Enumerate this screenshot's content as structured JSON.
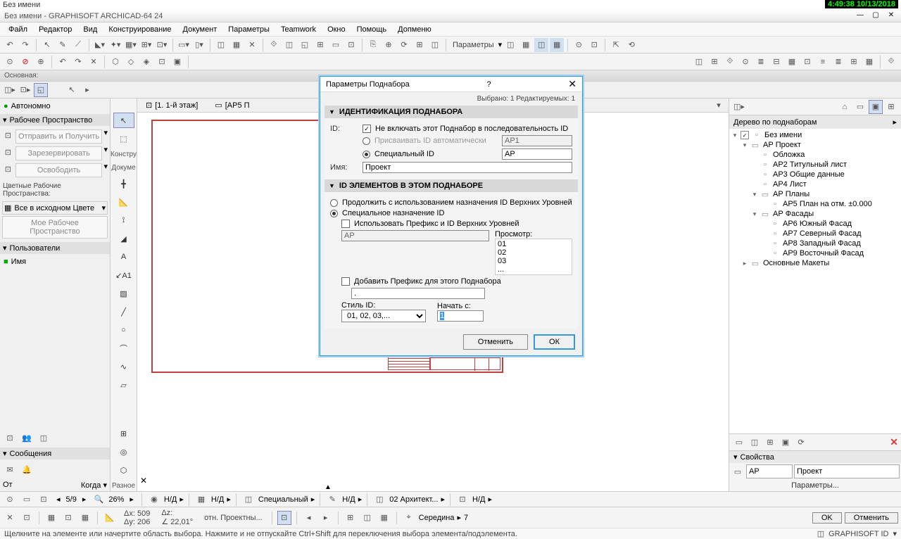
{
  "timestamp": "4:49:38  10/13/2018",
  "app_title": "Без имени - GRAPHISOFT ARCHICAD-64 24",
  "menu": [
    "Файл",
    "Редактор",
    "Вид",
    "Конструирование",
    "Документ",
    "Параметры",
    "Teamwork",
    "Окно",
    "Помощь",
    "Допменю"
  ],
  "toolbar_params": "Параметры",
  "left": {
    "header": "Основная:",
    "autonomous": "Автономно",
    "workspace": "Рабочее Пространство",
    "send_receive": "Отправить и Получить",
    "reserve": "Зарезервировать",
    "release": "Освободить",
    "color_spaces": "Цветные Рабочие Пространства:",
    "all_source": "Все в исходном Цвете",
    "my_workspace": "Мое Рабочее Пространство",
    "users": "Пользователи",
    "name": "Имя",
    "messages": "Сообщения",
    "from": "От",
    "when": "Когда"
  },
  "tools": {
    "label": "Констру",
    "sub": "Докуме"
  },
  "tabs": [
    {
      "label": "[1. 1-й этаж]"
    },
    {
      "label": "[АР5 П"
    }
  ],
  "right": {
    "header": "Дерево по поднаборам",
    "tree": [
      {
        "indent": 0,
        "toggle": "▾",
        "chk": "✓",
        "label": "Без имени"
      },
      {
        "indent": 1,
        "toggle": "▾",
        "chk": "✓",
        "label": "АР Проект",
        "sel": false,
        "folder": true
      },
      {
        "indent": 2,
        "toggle": "",
        "chk": "",
        "label": "Обложка"
      },
      {
        "indent": 2,
        "toggle": "",
        "chk": "",
        "label": "АР2 Титульный лист"
      },
      {
        "indent": 2,
        "toggle": "",
        "chk": "",
        "label": "АР3 Общие данные"
      },
      {
        "indent": 2,
        "toggle": "",
        "chk": "",
        "label": "АР4 Лист"
      },
      {
        "indent": 2,
        "toggle": "▾",
        "chk": "",
        "label": "АР Планы",
        "folder": true
      },
      {
        "indent": 3,
        "toggle": "",
        "chk": "",
        "label": "АР5 План на отм. ±0.000"
      },
      {
        "indent": 2,
        "toggle": "▾",
        "chk": "",
        "label": "АР Фасады",
        "folder": true
      },
      {
        "indent": 3,
        "toggle": "",
        "chk": "",
        "label": "АР6 Южный Фасад"
      },
      {
        "indent": 3,
        "toggle": "",
        "chk": "",
        "label": "АР7 Северный Фасад"
      },
      {
        "indent": 3,
        "toggle": "",
        "chk": "",
        "label": "АР8 Западный Фасад"
      },
      {
        "indent": 3,
        "toggle": "",
        "chk": "",
        "label": "АР9 Восточный Фасад"
      },
      {
        "indent": 1,
        "toggle": "▸",
        "chk": "",
        "label": "Основные Макеты",
        "folder": true
      }
    ],
    "props_title": "Свойства",
    "props_id": "АР",
    "props_name": "Проект",
    "props_link": "Параметры..."
  },
  "status": {
    "page": "5/9",
    "zoom": "26%",
    "nd": "Н/Д",
    "special": "Специальный",
    "arch": "02 Архитект...",
    "middle": "Середина",
    "layer_num": "7",
    "ax": "Δx: 509",
    "ay": "Δy: 206",
    "az": "Δz:",
    "ang": "∠ 22,01°",
    "info": "отн. Проектны...",
    "ok": "OK",
    "cancel": "Отменить"
  },
  "hint": "Щелкните на элементе или начертите область выбора. Нажмите и не отпускайте Ctrl+Shift для переключения выбора элемента/подэлемента.",
  "brand": "GRAPHISOFT ID",
  "dialog": {
    "title": "Параметры Поднабора",
    "selected": "Выбрано: 1 Редактируемых: 1",
    "sec1": "ИДЕНТИФИКАЦИЯ ПОДНАБОРА",
    "id_label": "ID:",
    "exclude": "Не включать этот Поднабор в последовательность ID",
    "auto_id": "Присваивать ID автоматически",
    "auto_val": "АР1",
    "special_id": "Специальный ID",
    "special_val": "АР",
    "name_label": "Имя:",
    "name_val": "Проект",
    "sec2": "ID ЭЛЕМЕНТОВ В ЭТОМ ПОДНАБОРЕ",
    "continue": "Продолжить с использованием назначения ID Верхних Уровней",
    "special_assign": "Специальное назначение ID",
    "use_prefix": "Использовать Префикс и ID Верхних Уровней",
    "prefix_val": "АР",
    "preview": "Просмотр:",
    "preview_lines": [
      "01",
      "02",
      "03",
      "..."
    ],
    "add_prefix": "Добавить Префикс для этого Поднабора",
    "dot_val": ".",
    "style_label": "Стиль ID:",
    "style_val": "01, 02, 03,...",
    "start_label": "Начать с:",
    "start_val": "1",
    "cancel": "Отменить",
    "ok": "ОК"
  }
}
